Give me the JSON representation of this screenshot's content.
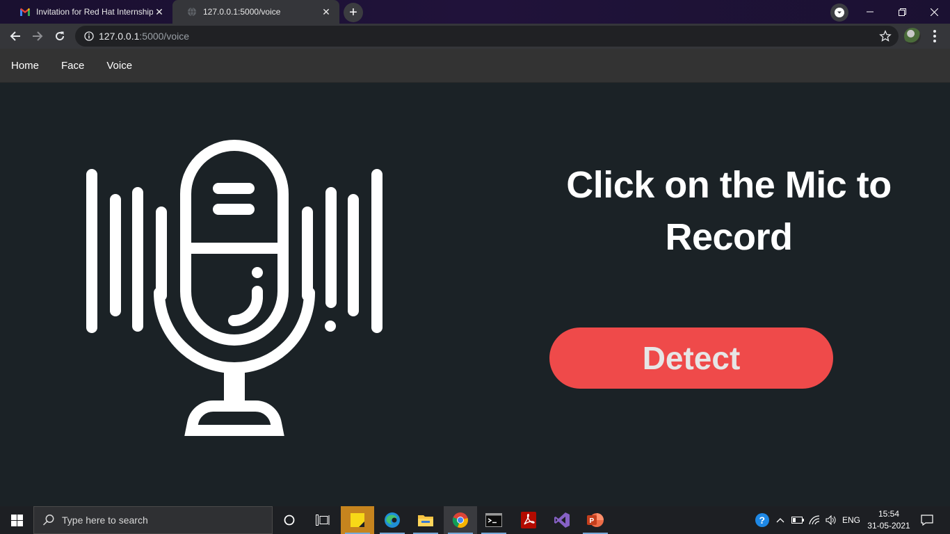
{
  "browser": {
    "tabs": [
      {
        "title": "Invitation for Red Hat Internship",
        "icon": "gmail-icon",
        "active": false
      },
      {
        "title": "127.0.0.1:5000/voice",
        "icon": "globe-icon",
        "active": true
      }
    ],
    "address": {
      "host": "127.0.0.1",
      "path": ":5000/voice"
    }
  },
  "site": {
    "nav": [
      {
        "label": "Home"
      },
      {
        "label": "Face"
      },
      {
        "label": "Voice"
      }
    ],
    "headline": "Click on the Mic to Record",
    "detect_label": "Detect",
    "colors": {
      "background": "#1b2226",
      "navbar": "#333333",
      "button": "#ef4a4a",
      "mic": "#ffffff"
    }
  },
  "taskbar": {
    "search_placeholder": "Type here to search",
    "apps": [
      "cortana-icon",
      "task-view-icon",
      "sticky-notes-icon",
      "edge-icon",
      "file-explorer-icon",
      "chrome-icon",
      "terminal-icon",
      "acrobat-icon",
      "visual-studio-icon",
      "powerpoint-icon"
    ],
    "language": "ENG",
    "time": "15:54",
    "date": "31-05-2021"
  }
}
